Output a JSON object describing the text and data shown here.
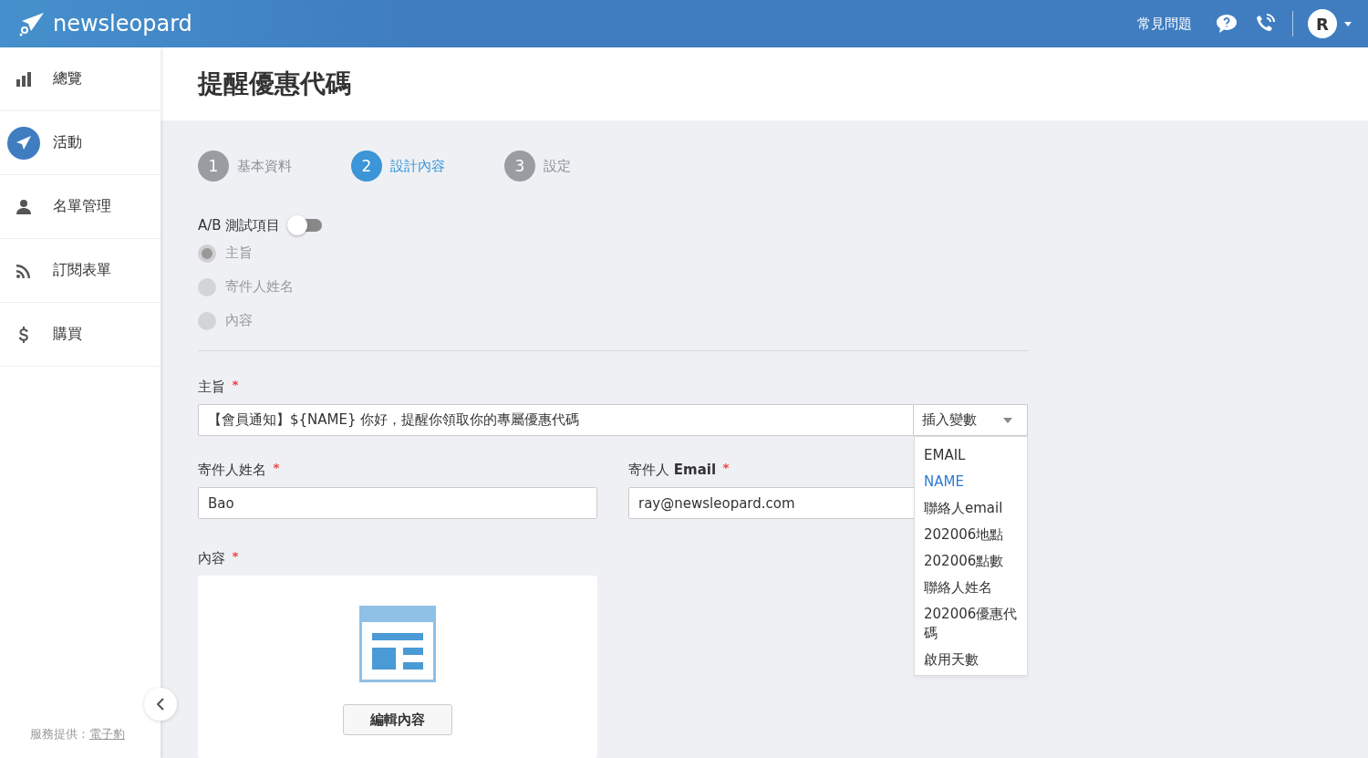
{
  "header": {
    "brand": "newsleopard",
    "faq_link": "常見問題",
    "avatar_initial": "R"
  },
  "sidebar": {
    "items": [
      {
        "label": "總覽",
        "selected": false
      },
      {
        "label": "活動",
        "selected": true
      },
      {
        "label": "名單管理",
        "selected": false
      },
      {
        "label": "訂閱表單",
        "selected": false
      },
      {
        "label": "購買",
        "selected": false
      }
    ],
    "footer_text": "服務提供：",
    "footer_link": "電子豹"
  },
  "page_title": "提醒優惠代碼",
  "steps": [
    {
      "number": "1",
      "label": "基本資料",
      "selected": false
    },
    {
      "number": "2",
      "label": "設計內容",
      "selected": true
    },
    {
      "number": "3",
      "label": "設定",
      "selected": false
    }
  ],
  "ab_test": {
    "label": "A/B 測試項目",
    "on": false,
    "options": [
      {
        "label": "主旨",
        "checked": true,
        "disabled": true
      },
      {
        "label": "寄件人姓名",
        "checked": false,
        "disabled": true
      },
      {
        "label": "內容",
        "checked": false,
        "disabled": true
      }
    ]
  },
  "subject": {
    "label": "主旨",
    "required": true,
    "value": "【會員通知】${NAME} 你好，提醒你領取你的專屬優惠代碼",
    "insert_button": "插入變數",
    "variables": [
      {
        "label": "EMAIL",
        "selected": false
      },
      {
        "label": "NAME",
        "selected": true
      },
      {
        "label": "聯絡人email",
        "selected": false
      },
      {
        "label": "202006地點",
        "selected": false
      },
      {
        "label": "202006點數",
        "selected": false
      },
      {
        "label": "聯絡人姓名",
        "selected": false
      },
      {
        "label": "202006優惠代碼",
        "selected": false
      },
      {
        "label": "啟用天數",
        "selected": false
      }
    ]
  },
  "sender_name": {
    "label": "寄件人姓名",
    "required": true,
    "value": "Bao"
  },
  "sender_email": {
    "label": "寄件人 **Email**",
    "required": true,
    "value": "ray@newsleopard.com"
  },
  "content": {
    "label": "內容",
    "required": true,
    "edit_button": "編輯內容"
  }
}
